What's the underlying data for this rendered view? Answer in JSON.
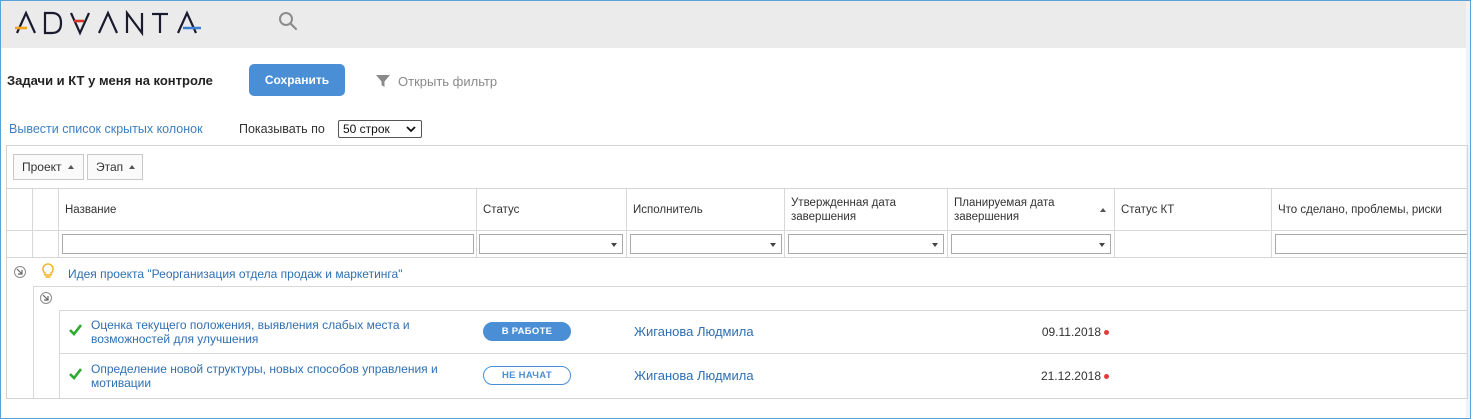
{
  "brand": {
    "name": "ADVANTA",
    "colors": {
      "orange": "#f4a11b",
      "red": "#e1322a",
      "blue": "#3a7fd5",
      "dark": "#1b1b2f"
    }
  },
  "header": {
    "search_icon": "search-icon"
  },
  "toolbar": {
    "title": "Задачи и КТ у меня на контроле",
    "save_label": "Сохранить",
    "filter_label": "Открыть фильтр"
  },
  "options": {
    "hidden_columns_link": "Вывести список скрытых колонок",
    "show_label": "Показывать по",
    "rows_select_value": "50 строк"
  },
  "grouping": {
    "chips": [
      "Проект",
      "Этап"
    ]
  },
  "table": {
    "columns": [
      {
        "label": "Название"
      },
      {
        "label": "Статус"
      },
      {
        "label": "Исполнитель"
      },
      {
        "label": "Утвержденная дата завершения"
      },
      {
        "label": "Планируемая дата завершения",
        "sorted": "asc"
      },
      {
        "label": "Статус КТ"
      },
      {
        "label": "Что сделано, проблемы, риски"
      }
    ],
    "project_group": "Идея проекта \"Реорганизация отдела продаж и маркетинга\"",
    "rows": [
      {
        "name": "Оценка текущего положения, выявления слабых места и возможностей для улучшения",
        "status": "В РАБОТЕ",
        "assignee": "Жиганова Людмила",
        "planned_date": "09.11.2018"
      },
      {
        "name": "Определение новой структуры, новых способов управления и мотивации",
        "status": "НЕ НАЧАТ",
        "assignee": "Жиганова Людмила",
        "planned_date": "21.12.2018"
      }
    ]
  },
  "colors": {
    "accent": "#4a8fd6",
    "link": "#2f6fb1",
    "check": "#2eaa2e",
    "overdue_dot": "#e23b3b",
    "bulb": "#f0b429"
  }
}
